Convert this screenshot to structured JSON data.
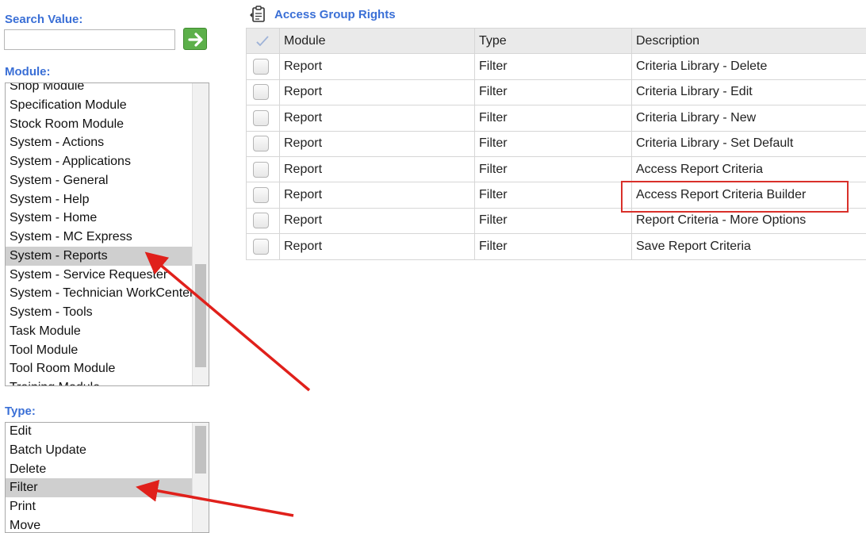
{
  "search": {
    "label": "Search Value:",
    "value": "",
    "placeholder": ""
  },
  "module": {
    "label": "Module:",
    "items": [
      "Shop Module",
      "Specification Module",
      "Stock Room Module",
      "System - Actions",
      "System - Applications",
      "System - General",
      "System - Help",
      "System - Home",
      "System - MC Express",
      "System - Reports",
      "System - Service Requester",
      "System - Technician WorkCenter",
      "System - Tools",
      "Task Module",
      "Tool Module",
      "Tool Room Module",
      "Training Module"
    ],
    "selected": "System - Reports"
  },
  "type": {
    "label": "Type:",
    "items": [
      "Edit",
      "Batch Update",
      "Delete",
      "Filter",
      "Print",
      "Move"
    ],
    "selected": "Filter"
  },
  "grid": {
    "title": "Access Group Rights",
    "columns": [
      "Module",
      "Type",
      "Description"
    ],
    "rows": [
      {
        "module": "Report",
        "type": "Filter",
        "description": "Criteria Library - Delete"
      },
      {
        "module": "Report",
        "type": "Filter",
        "description": "Criteria Library - Edit"
      },
      {
        "module": "Report",
        "type": "Filter",
        "description": "Criteria Library - New"
      },
      {
        "module": "Report",
        "type": "Filter",
        "description": "Criteria Library - Set Default"
      },
      {
        "module": "Report",
        "type": "Filter",
        "description": "Access Report Criteria"
      },
      {
        "module": "Report",
        "type": "Filter",
        "description": "Access Report Criteria Builder"
      },
      {
        "module": "Report",
        "type": "Filter",
        "description": "Report Criteria - More Options"
      },
      {
        "module": "Report",
        "type": "Filter",
        "description": "Save Report Criteria"
      }
    ],
    "highlighted_row": "Access Report Criteria Builder"
  },
  "colors": {
    "label_blue": "#3a6fd6",
    "go_green": "#5cb04a",
    "annotation_red": "#d9302a",
    "selected_gray": "#cfcfcf"
  }
}
